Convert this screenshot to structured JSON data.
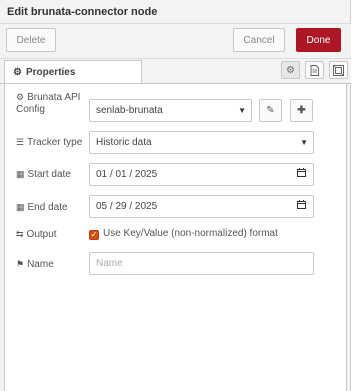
{
  "title": "Edit brunata-connector node",
  "toolbar": {
    "delete_label": "Delete",
    "cancel_label": "Cancel",
    "done_label": "Done",
    "done_color": "#ad1625"
  },
  "tabs": [
    {
      "label": "Properties",
      "icon": "gear-icon"
    }
  ],
  "tab_buttons": [
    {
      "icon": "gear-icon",
      "active": true
    },
    {
      "icon": "document-icon",
      "active": false
    },
    {
      "icon": "layout-icon",
      "active": false
    }
  ],
  "form": {
    "config": {
      "label_line1": "Brunata API",
      "label_line2": "Config",
      "icon": "gear-icon",
      "value": "senlab-brunata"
    },
    "tracker": {
      "label": "Tracker type",
      "icon": "table-icon",
      "value": "Historic data"
    },
    "start_date": {
      "label": "Start date",
      "icon": "calendar-icon",
      "value": "01 / 01 / 2025"
    },
    "end_date": {
      "label": "End date",
      "icon": "calendar-icon",
      "value": "05 / 29 / 2025"
    },
    "output": {
      "label": "Output",
      "icon": "exchange-icon",
      "checkbox_label": "Use Key/Value (non-normalized) format",
      "checked": true
    },
    "name": {
      "label": "Name",
      "icon": "tag-icon",
      "placeholder": "Name",
      "value": ""
    }
  }
}
